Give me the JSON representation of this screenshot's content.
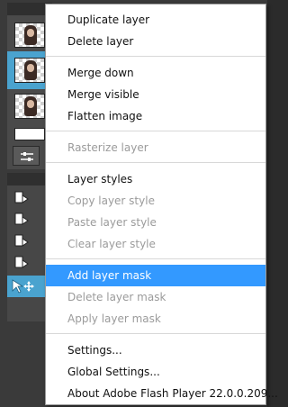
{
  "colors": {
    "menu_background": "#ffffff",
    "menu_highlight": "#3399ff",
    "menu_text": "#111111",
    "menu_disabled_text": "#9b9b9b",
    "selected_layer": "#4aa3cf",
    "panel_background": "#3a3a3a"
  },
  "menu": {
    "items": [
      {
        "label": "Duplicate layer",
        "enabled": true
      },
      {
        "label": "Delete layer",
        "enabled": true
      },
      {
        "label": "Merge down",
        "enabled": true
      },
      {
        "label": "Merge visible",
        "enabled": true
      },
      {
        "label": "Flatten image",
        "enabled": true
      },
      {
        "label": "Rasterize layer",
        "enabled": false
      },
      {
        "label": "Layer styles",
        "enabled": true
      },
      {
        "label": "Copy layer style",
        "enabled": false
      },
      {
        "label": "Paste layer style",
        "enabled": false
      },
      {
        "label": "Clear layer style",
        "enabled": false
      },
      {
        "label": "Add layer mask",
        "enabled": true,
        "highlighted": true
      },
      {
        "label": "Delete layer mask",
        "enabled": false
      },
      {
        "label": "Apply layer mask",
        "enabled": false
      },
      {
        "label": "Settings...",
        "enabled": true
      },
      {
        "label": "Global Settings...",
        "enabled": true
      },
      {
        "label": "About Adobe Flash Player 22.0.0.209...",
        "enabled": true
      }
    ]
  },
  "layers_panel": {
    "icons": [
      "layer-thumbnail-icon",
      "adjustment-sliders-icon"
    ]
  },
  "actions_panel": {
    "icons": [
      "action-play-icon",
      "move-cursor-icon"
    ]
  }
}
